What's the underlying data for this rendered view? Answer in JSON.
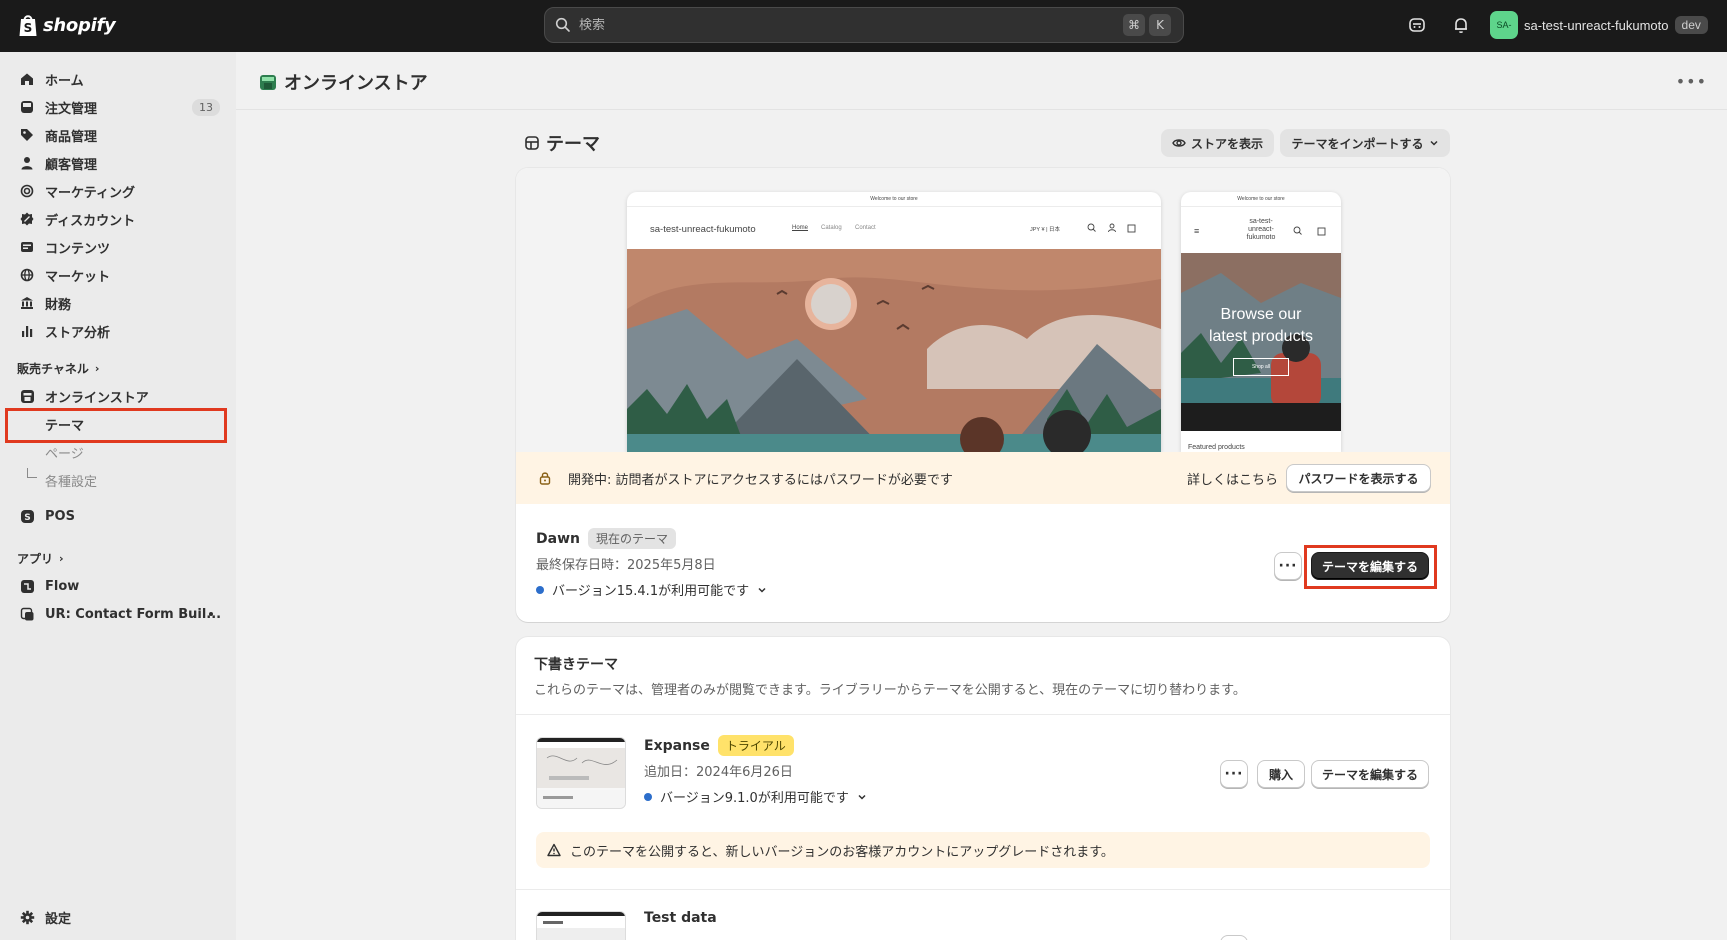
{
  "topbar": {
    "logo_text": "shopify",
    "search_placeholder": "検索",
    "shortcut_keys": [
      "⌘",
      "K"
    ],
    "store_name": "sa-test-unreact-fukumoto",
    "avatar_initials": "SA-",
    "env_badge": "dev"
  },
  "sidebar": {
    "items": [
      {
        "label": "ホーム",
        "icon": "home-icon"
      },
      {
        "label": "注文管理",
        "icon": "inbox-icon",
        "count": "13"
      },
      {
        "label": "商品管理",
        "icon": "tag-icon"
      },
      {
        "label": "顧客管理",
        "icon": "person-icon"
      },
      {
        "label": "マーケティング",
        "icon": "target-icon"
      },
      {
        "label": "ディスカウント",
        "icon": "discount-icon"
      },
      {
        "label": "コンテンツ",
        "icon": "content-icon"
      },
      {
        "label": "マーケット",
        "icon": "globe-icon"
      },
      {
        "label": "財務",
        "icon": "bank-icon"
      },
      {
        "label": "ストア分析",
        "icon": "chart-icon"
      }
    ],
    "sales_channels_label": "販売チャネル",
    "online_store": "オンラインストア",
    "online_store_sub": [
      "テーマ",
      "ページ",
      "各種設定"
    ],
    "pos": "POS",
    "apps_label": "アプリ",
    "apps": [
      "Flow",
      "UR: Contact Form Buil..."
    ],
    "settings": "設定"
  },
  "header": {
    "title": "オンラインストア"
  },
  "themes": {
    "title": "テーマ",
    "view_store": "ストアを表示",
    "import_theme": "テーマをインポートする",
    "preview": {
      "announcement": "Welcome to our store",
      "store_name": "sa-test-unreact-fukumoto",
      "store_name_mobile": [
        "sa-test-",
        "unreact-",
        "fukumoto"
      ],
      "nav": [
        "Home",
        "Catalog",
        "Contact"
      ],
      "currency": "JPY ¥ | 日本",
      "mobile_heading": [
        "Browse our",
        "latest products"
      ],
      "mobile_button": "Shop all",
      "mobile_featured": "Featured products"
    },
    "password_notice": "開発中: 訪問者がストアにアクセスするにはパスワードが必要です",
    "learn_more": "詳しくはこちら",
    "show_password": "パスワードを表示する",
    "current": {
      "name": "Dawn",
      "badge": "現在のテーマ",
      "saved": "最終保存日時：2025年5月8日",
      "version": "バージョン15.4.1が利用可能です",
      "edit": "テーマを編集する"
    }
  },
  "drafts": {
    "title": "下書きテーマ",
    "description": "これらのテーマは、管理者のみが閲覧できます。ライブラリーからテーマを公開すると、現在のテーマに切り替わります。",
    "items": [
      {
        "name": "Expanse",
        "badge": "トライアル",
        "added": "追加日：2024年6月26日",
        "version": "バージョン9.1.0が利用可能です",
        "buy": "購入",
        "edit": "テーマを編集する",
        "warning": "このテーマを公開すると、新しいバージョンのお客様アカウントにアップグレードされます。"
      },
      {
        "name": "Test data"
      }
    ]
  }
}
